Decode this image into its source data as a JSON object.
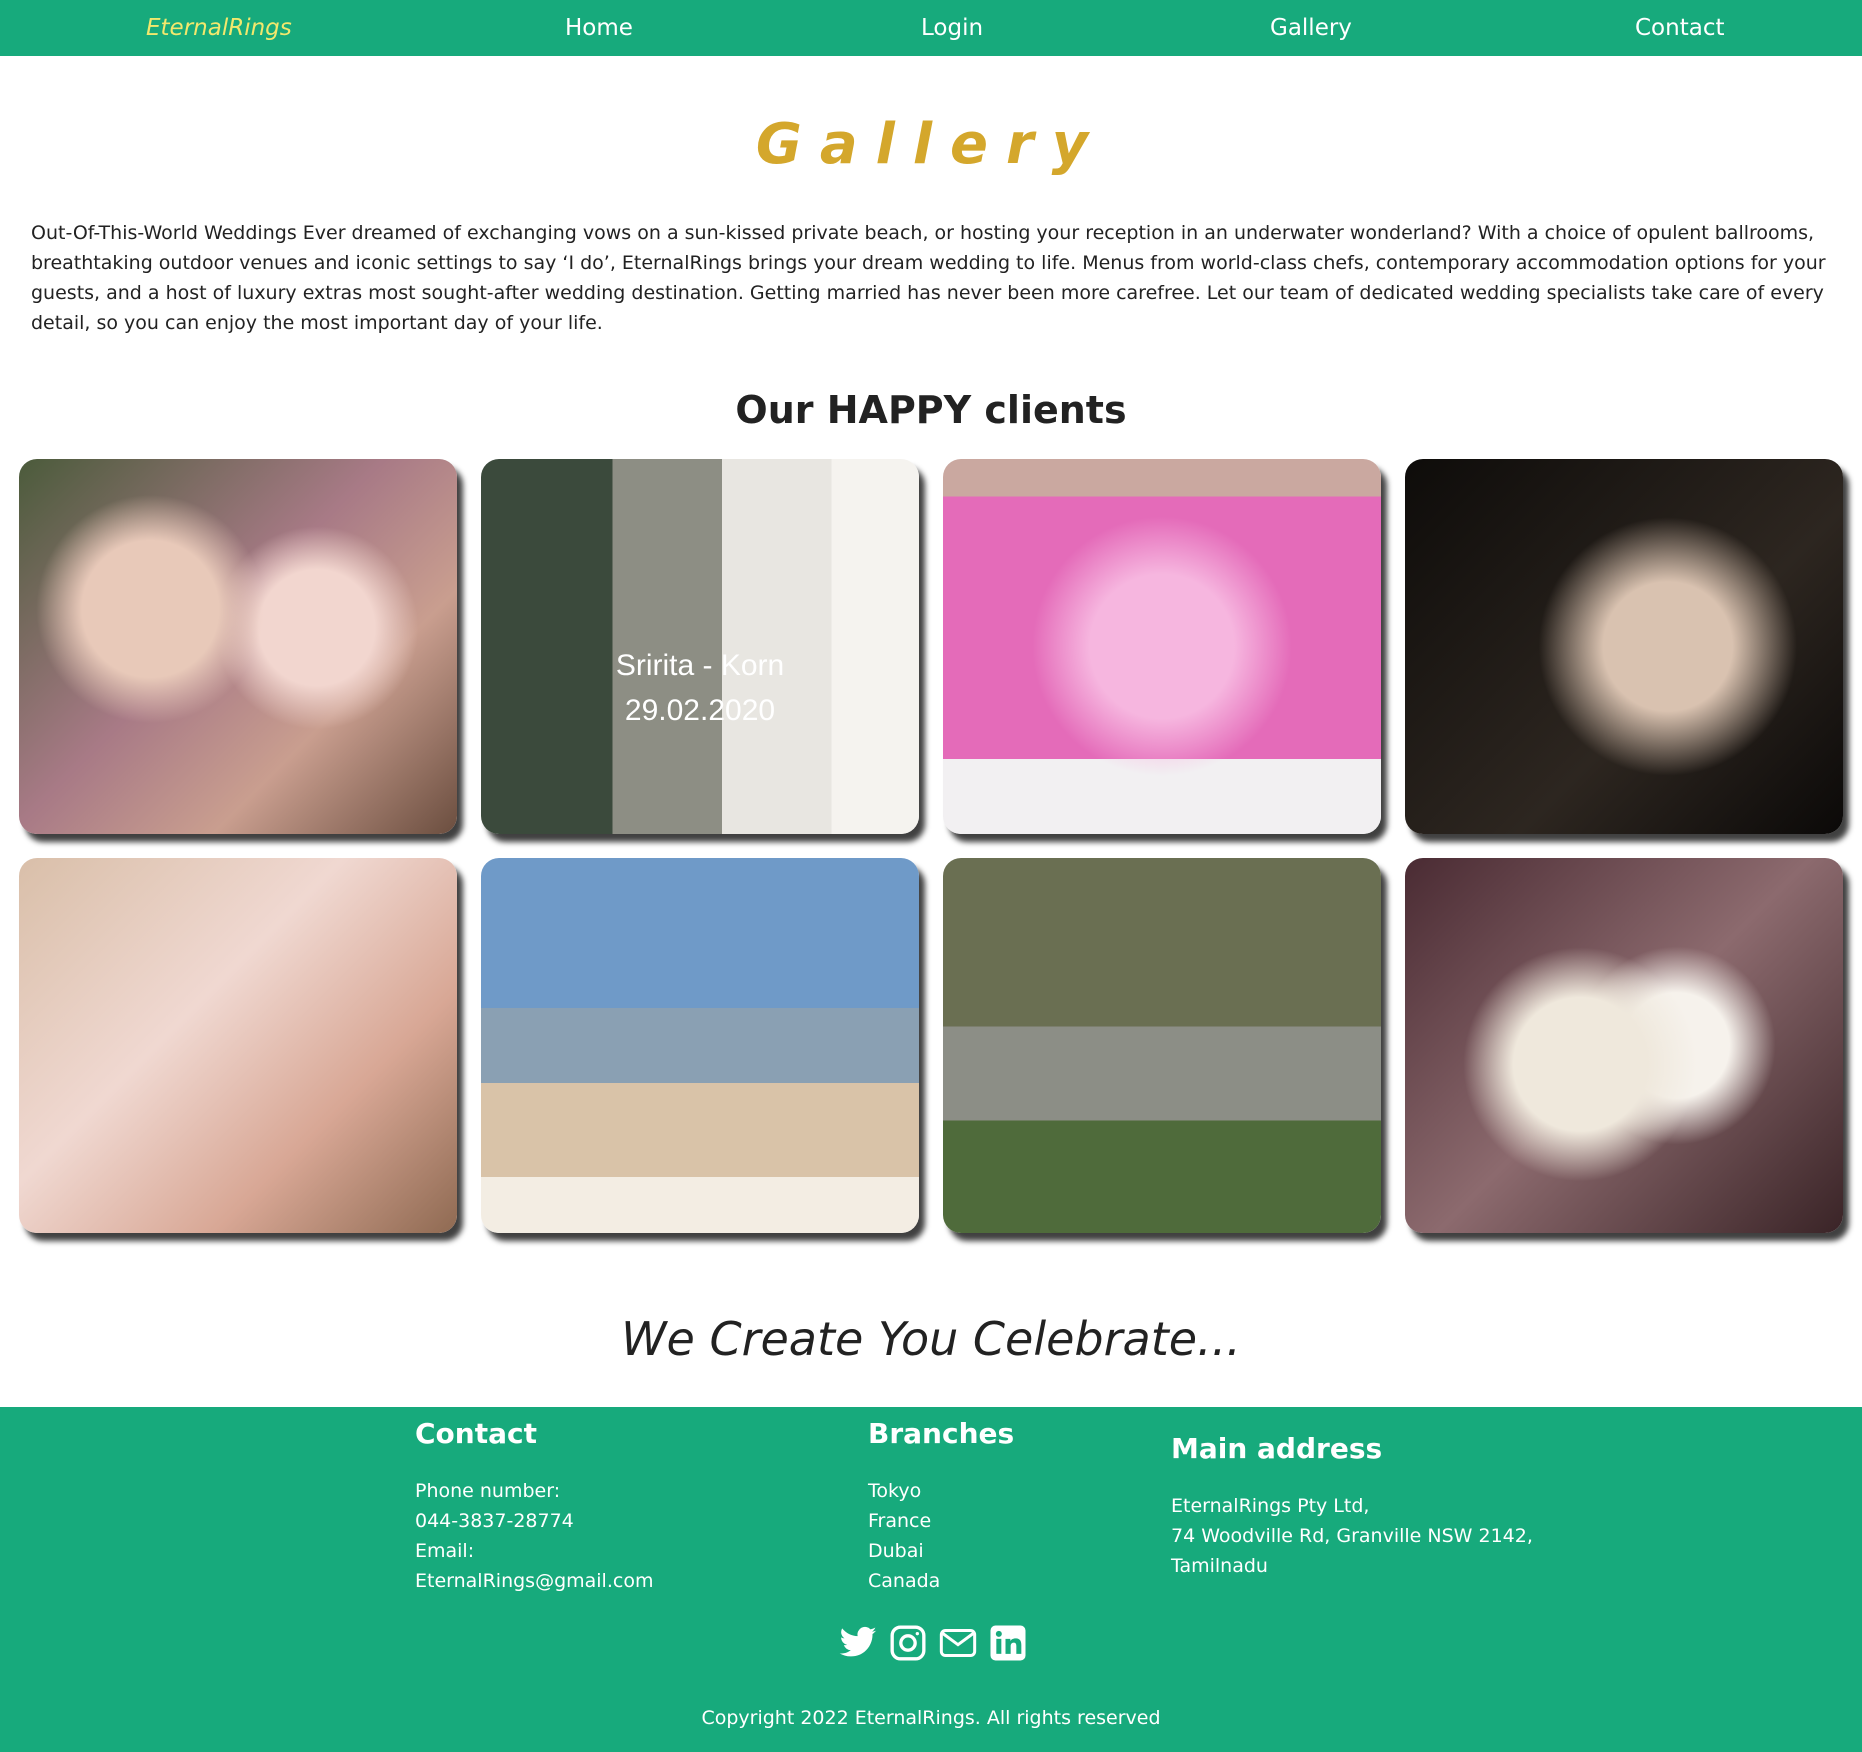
{
  "nav": {
    "brand": "EternalRings",
    "links": [
      "Home",
      "Login",
      "Gallery",
      "Contact"
    ]
  },
  "page": {
    "title": "Gallery",
    "intro": "Out-Of-This-World Weddings Ever dreamed of exchanging vows on a sun-kissed private beach, or hosting your reception in an underwater wonderland? With a choice of opulent ballrooms, breathtaking outdoor venues and iconic settings to say ‘I do’, EternalRings brings your dream wedding to life. Menus from world-class chefs, contemporary accommodation options for your guests, and a host of luxury extras most sought-after wedding destination. Getting married has never been more carefree. Let our team of dedicated wedding specialists take care of every detail, so you can enjoy the most important day of your life.",
    "clients_heading": "Our HAPPY clients",
    "photo2_caption_line1": "Sririta - Korn",
    "photo2_caption_line2": "29.02.2020",
    "tagline": "We Create You Celebrate..."
  },
  "footer": {
    "contact": {
      "heading": "Contact",
      "lines": [
        "Phone number:",
        "044-3837-28774",
        "Email:",
        "EternalRings@gmail.com"
      ]
    },
    "branches": {
      "heading": "Branches",
      "lines": [
        "Tokyo",
        "France",
        "Dubai",
        "Canada"
      ]
    },
    "address": {
      "heading": "Main address",
      "lines": [
        "EternalRings Pty Ltd,",
        "74 Woodville Rd, Granville NSW 2142,",
        "Tamilnadu"
      ]
    },
    "social_icons": [
      "twitter-icon",
      "instagram-icon",
      "mail-icon",
      "linkedin-icon"
    ],
    "copyright": "Copyright 2022 EternalRings. All rights reserved"
  },
  "colors": {
    "brand_green": "#17aa7c",
    "brand_text_yellow": "#f2e86d",
    "gallery_gold": "#d4a72c"
  }
}
